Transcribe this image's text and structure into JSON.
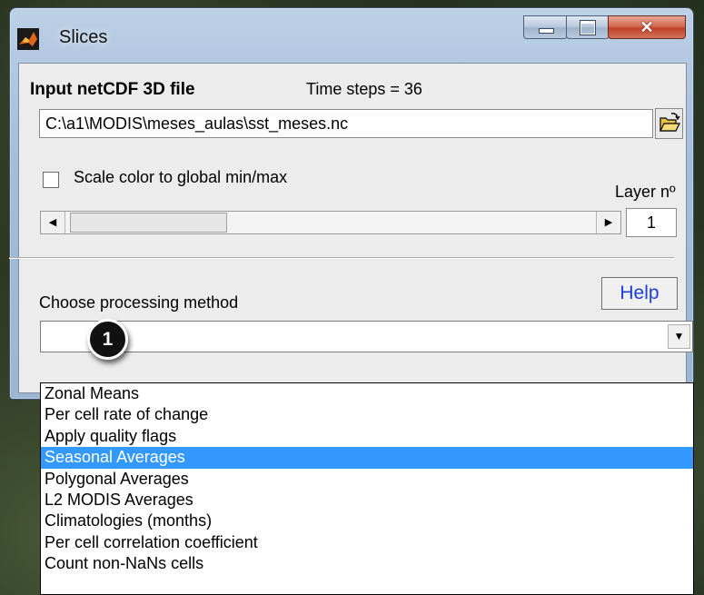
{
  "window": {
    "title": "Slices"
  },
  "input": {
    "label": "Input netCDF 3D file",
    "time_steps": "Time steps = 36",
    "file_path": "C:\\a1\\MODIS\\meses_aulas\\sst_meses.nc"
  },
  "options": {
    "scale_color_label": "Scale color to global min/max",
    "scale_color_checked": false,
    "layer_label": "Layer nº",
    "layer_value": "1"
  },
  "method": {
    "label": "Choose processing method",
    "help_label": "Help",
    "selected_value": "",
    "badge": "1",
    "options": [
      "Zonal Means",
      "Per cell rate of change",
      "Apply quality flags",
      "Seasonal Averages",
      "Polygonal Averages",
      "L2 MODIS Averages",
      "Climatologies (months)",
      "Per cell correlation coefficient",
      "Count non-NaNs cells"
    ],
    "highlighted_option": "Seasonal Averages"
  },
  "icons": {
    "app": "matlab-icon",
    "folder": "open-folder-icon",
    "minimize": "minimize-icon",
    "maximize": "maximize-icon",
    "close": "close-icon",
    "dropdown": "chevron-down-icon"
  },
  "colors": {
    "selection": "#3399ff",
    "help_text": "#1b3fd8",
    "close_button": "#c0422a"
  }
}
